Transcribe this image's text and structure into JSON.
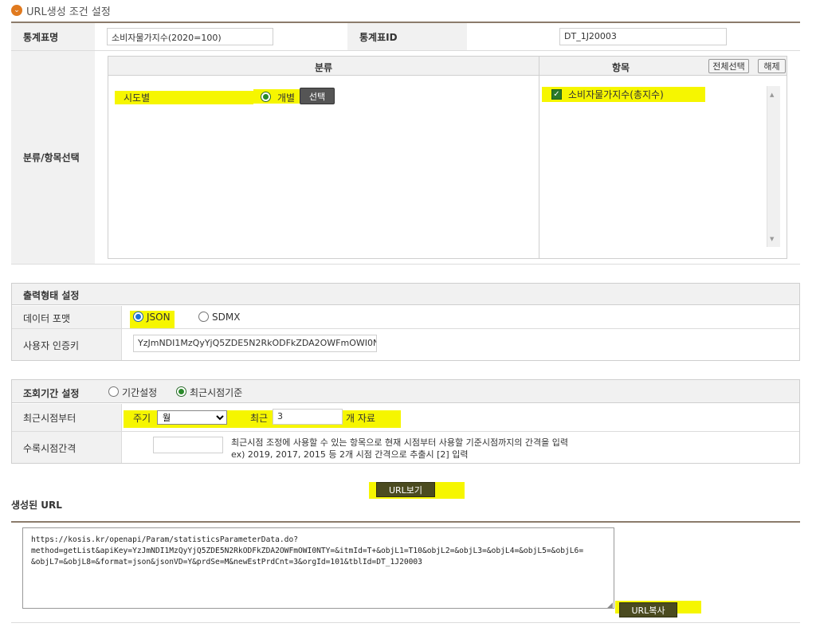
{
  "header": {
    "title": "URL생성 조건 설정",
    "icon": "chevron-down-icon"
  },
  "stat": {
    "name_label": "통계표명",
    "name_value": "소비자물가지수(2020=100)",
    "id_label": "통계표ID",
    "id_value": "DT_1J20003"
  },
  "classification": {
    "row_label": "분류/항목선택",
    "col_class": "분류",
    "col_item": "항목",
    "select_all": "전체선택",
    "deselect": "해제",
    "class_value": "시도별",
    "radio_individual": "개별",
    "select_button": "선택",
    "item_checked": "소비자물가지수(총지수)"
  },
  "output": {
    "title": "출력형태 설정",
    "format_label": "데이터 포맷",
    "json": "JSON",
    "sdmx": "SDMX",
    "key_label": "사용자 인증키",
    "key_value": "YzJmNDI1MzQyYjQ5ZDE5N2RkODFkZDA2OWFmOWI0N"
  },
  "period": {
    "title": "조회기간 설정",
    "opt_range": "기간설정",
    "opt_recent": "최근시점기준",
    "recent_label": "최근시점부터",
    "cycle_label": "주기",
    "cycle_value": "월",
    "recent_word": "최근",
    "recent_count": "3",
    "unit_suffix": "개 자료",
    "interval_label": "수록시점간격",
    "interval_help1": "최근시점 조정에 사용할 수 있는 항목으로 현재 시점부터 사용할 기준시점까지의 간격을 입력",
    "interval_help2": "ex) 2019, 2017, 2015 등 2개 시점 간격으로 추출시 [2] 입력"
  },
  "url": {
    "view_button": "URL보기",
    "generated_label": "생성된 URL",
    "text": "https://kosis.kr/openapi/Param/statisticsParameterData.do?\nmethod=getList&apiKey=YzJmNDI1MzQyYjQ5ZDE5N2RkODFkZDA2OWFmOWI0NTY=&itmId=T+&objL1=T10&objL2=&objL3=&objL4=&objL5=&objL6=\n&objL7=&objL8=&format=json&jsonVD=Y&prdSe=M&newEstPrdCnt=3&orgId=101&tblId=DT_1J20003",
    "copy_button": "URL복사"
  },
  "colors": {
    "highlight": "#f6f600",
    "accent": "#e07a1f",
    "olive": "#4b4b20"
  }
}
